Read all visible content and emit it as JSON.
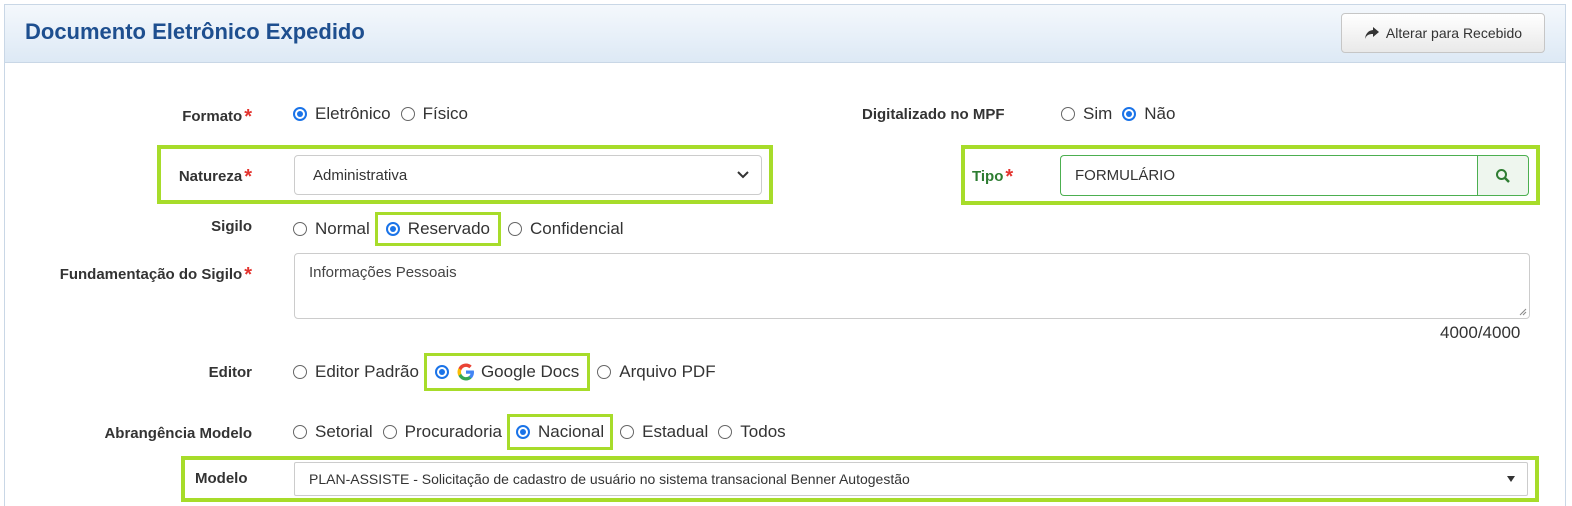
{
  "panel": {
    "title": "Documento Eletrônico Expedido",
    "switch_button": "Alterar para Recebido"
  },
  "required_mark": "*",
  "formato": {
    "label": "Formato",
    "options": [
      "Eletrônico",
      "Físico"
    ],
    "selected": "Eletrônico"
  },
  "digitalizado": {
    "label": "Digitalizado no MPF",
    "options": [
      "Sim",
      "Não"
    ],
    "selected": "Não"
  },
  "natureza": {
    "label": "Natureza",
    "value": "Administrativa"
  },
  "tipo": {
    "label": "Tipo",
    "value": "FORMULÁRIO"
  },
  "sigilo": {
    "label": "Sigilo",
    "options": [
      "Normal",
      "Reservado",
      "Confidencial"
    ],
    "selected": "Reservado"
  },
  "fundamentacao": {
    "label": "Fundamentação do Sigilo",
    "value": "Informações Pessoais",
    "counter": "4000/4000"
  },
  "editor": {
    "label": "Editor",
    "options": [
      "Editor Padrão",
      "Google Docs",
      "Arquivo PDF"
    ],
    "selected": "Google Docs"
  },
  "abrangencia": {
    "label": "Abrangência Modelo",
    "options": [
      "Setorial",
      "Procuradoria",
      "Nacional",
      "Estadual",
      "Todos"
    ],
    "selected": "Nacional"
  },
  "modelo": {
    "label": "Modelo",
    "value": "PLAN-ASSISTE - Solicitação de cadastro de usuário no sistema transacional Benner Autogestão"
  },
  "colors": {
    "title": "#1e4f8f",
    "highlight": "#a7dc2a",
    "radio_accent": "#1a73e8",
    "required": "#e3342f"
  },
  "icons": {
    "switch": "share-arrow-icon",
    "search": "search-icon",
    "dropdown": "chevron-down-icon",
    "google": "google-g-icon"
  }
}
